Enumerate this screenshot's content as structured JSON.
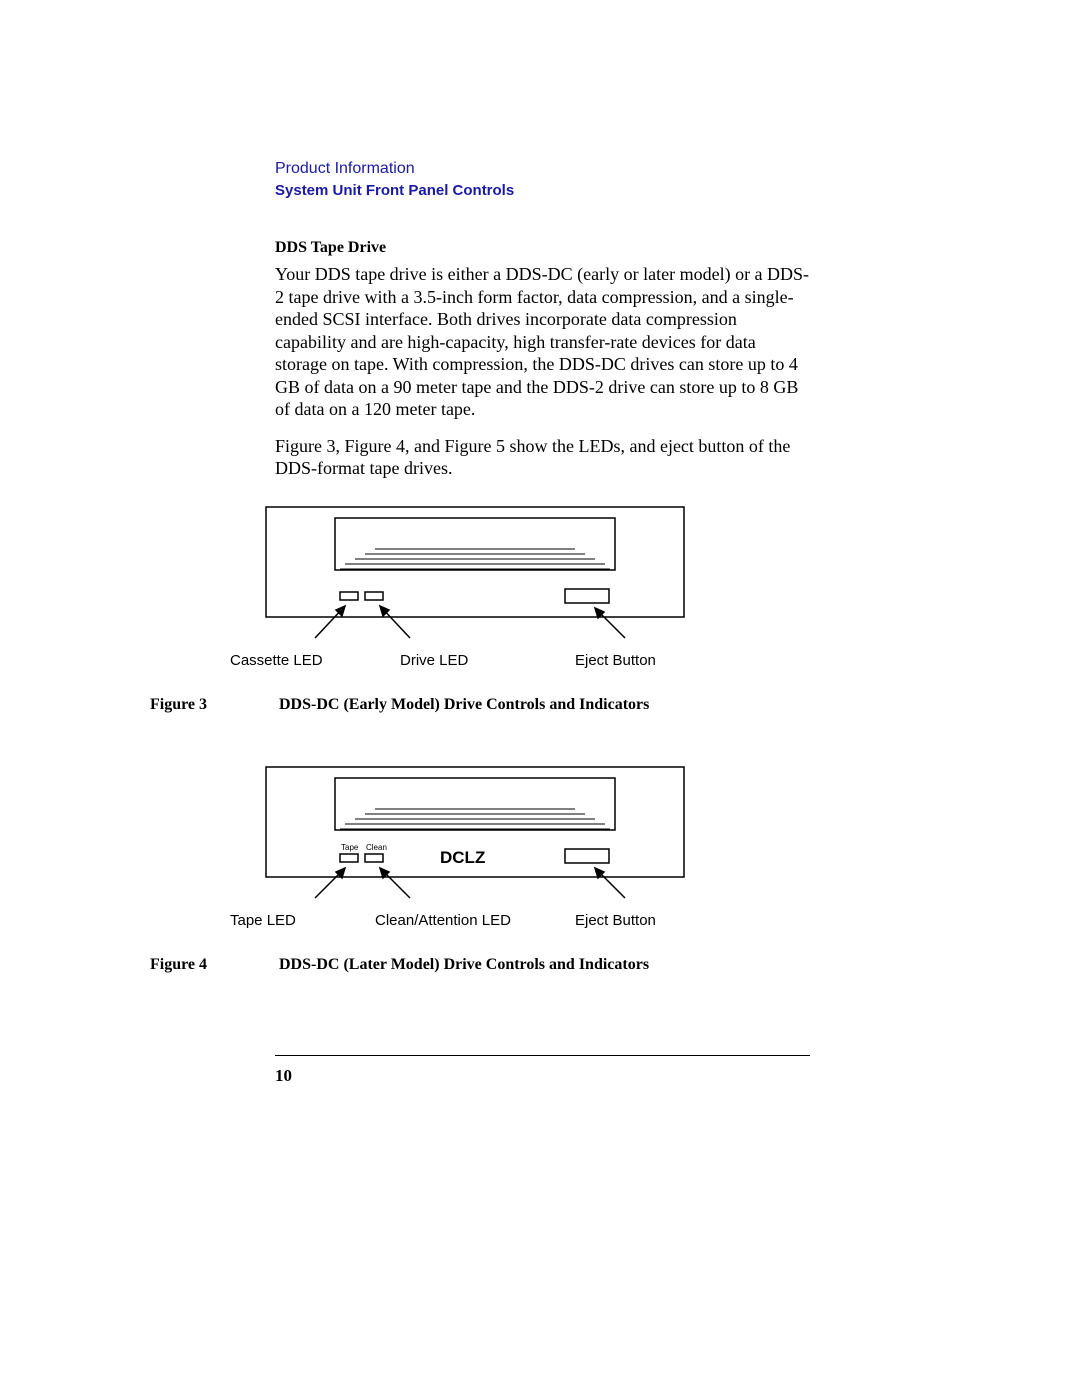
{
  "header": {
    "product_info": "Product Information",
    "section_title": "System Unit Front Panel Controls"
  },
  "subhead": "DDS Tape Drive",
  "para1": "Your DDS tape drive is either a DDS-DC (early or later model) or a DDS-2 tape drive with a 3.5-inch form factor, data compression, and a single-ended SCSI interface. Both drives incorporate data compression capability and are high-capacity, high transfer-rate devices for data storage on tape. With compression, the DDS-DC drives can store up to 4 GB of data on a 90 meter tape and  the DDS-2 drive can store up to 8 GB of data on a 120 meter tape.",
  "para2": "Figure 3, Figure 4, and Figure 5 show the LEDs, and eject button of the DDS-format tape drives.",
  "figure3": {
    "labels": {
      "left": "Cassette LED",
      "mid": "Drive LED",
      "right": "Eject Button"
    },
    "caption_num": "Figure 3",
    "caption_text": "DDS-DC (Early Model) Drive Controls and Indicators"
  },
  "figure4": {
    "led_tape": "Tape",
    "led_clean": "Clean",
    "dclz": "DCLZ",
    "labels": {
      "left": "Tape LED",
      "mid": "Clean/Attention LED",
      "right": "Eject Button"
    },
    "caption_num": "Figure 4",
    "caption_text": "DDS-DC (Later Model) Drive Controls and Indicators"
  },
  "page_number": "10"
}
